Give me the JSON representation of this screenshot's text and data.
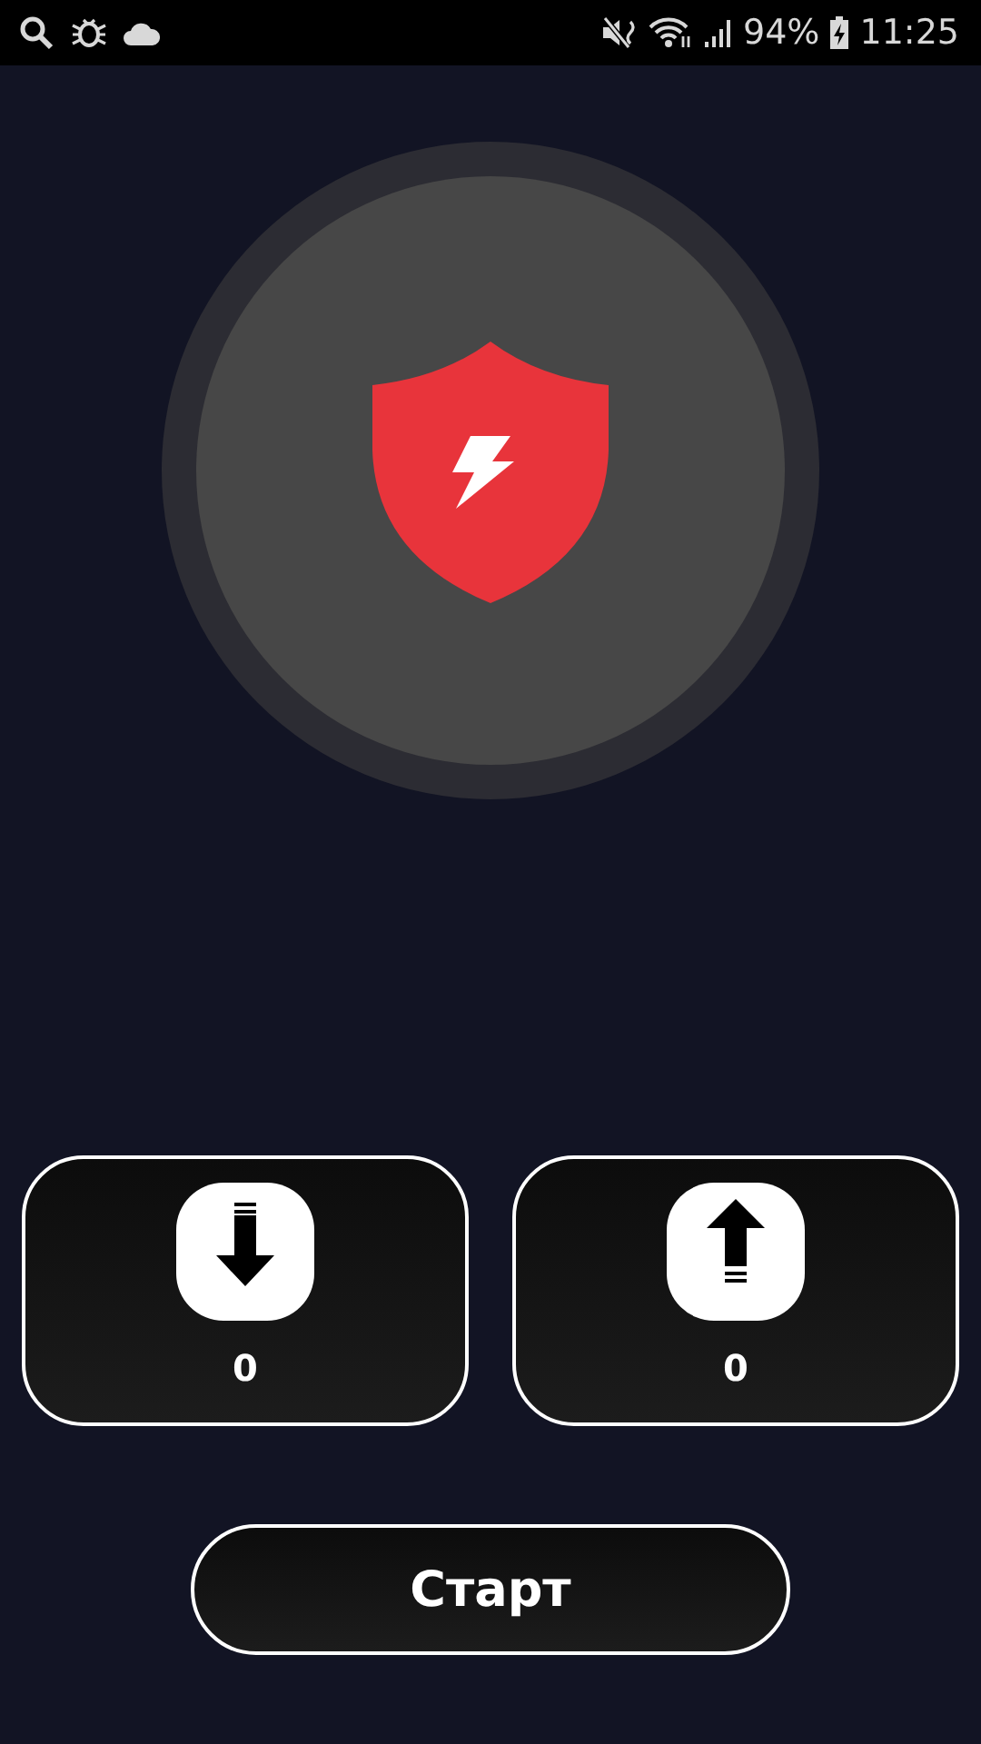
{
  "status_bar": {
    "battery": "94%",
    "time": "11:25"
  },
  "stats": [
    {
      "kind": "download",
      "value": "0"
    },
    {
      "kind": "upload",
      "value": "0"
    }
  ],
  "start_button": {
    "label": "Старт"
  }
}
